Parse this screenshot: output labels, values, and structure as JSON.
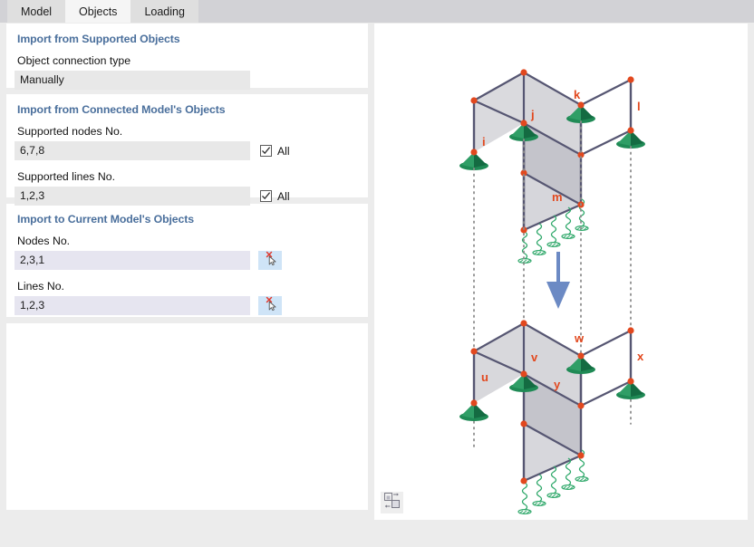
{
  "tabs": [
    {
      "label": "Model",
      "active": false,
      "name": "tab-model"
    },
    {
      "label": "Objects",
      "active": true,
      "name": "tab-objects"
    },
    {
      "label": "Loading",
      "active": false,
      "name": "tab-loading"
    }
  ],
  "sections": {
    "supported_objects": {
      "title": "Import from Supported Objects",
      "connection_type_label": "Object connection type",
      "connection_type_value": "Manually"
    },
    "connected_model": {
      "title": "Import from Connected Model's Objects",
      "nodes_label": "Supported nodes No.",
      "nodes_value": "6,7,8",
      "nodes_all_label": "All",
      "nodes_all_checked": true,
      "lines_label": "Supported lines No.",
      "lines_value": "1,2,3",
      "lines_all_label": "All",
      "lines_all_checked": true
    },
    "current_model": {
      "title": "Import to Current Model's Objects",
      "nodes_label": "Nodes No.",
      "nodes_value": "2,3,1",
      "lines_label": "Lines No.",
      "lines_value": "1,2,3",
      "pick_icon": "select-cursor-icon"
    }
  },
  "viewport": {
    "tool_icon": "transfer-objects-icon",
    "node_labels_upper": [
      "i",
      "j",
      "k",
      "l",
      "m"
    ],
    "node_labels_lower": [
      "u",
      "v",
      "w",
      "x",
      "y"
    ],
    "arrow_icon": "down-arrow-icon"
  },
  "colors": {
    "accent_header": "#4a6f9c",
    "node_marker": "#e2481e",
    "support_green": "#1f8a55",
    "member_line": "#565672",
    "arrow_blue": "#6c8ac4",
    "pick_field_bg": "#e6e5f0",
    "pick_button_bg": "#cfe4f7"
  }
}
